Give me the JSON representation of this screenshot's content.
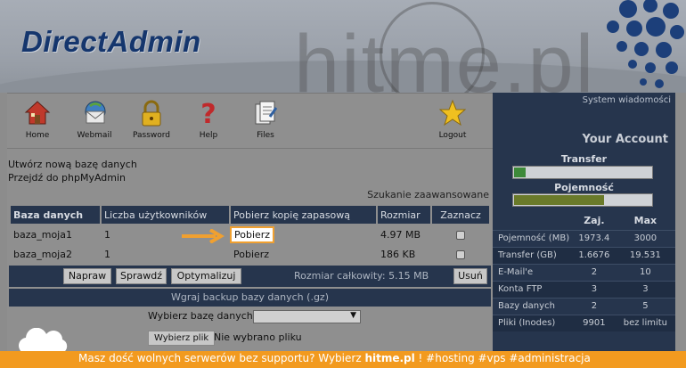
{
  "header": {
    "logo_text": "DirectAdmin",
    "watermark": "hitme.pl"
  },
  "toolbar": {
    "items": [
      {
        "label": "Home",
        "icon": "home-icon"
      },
      {
        "label": "Webmail",
        "icon": "webmail-icon"
      },
      {
        "label": "Password",
        "icon": "lock-icon"
      },
      {
        "label": "Help",
        "icon": "question-icon"
      },
      {
        "label": "Files",
        "icon": "files-icon"
      },
      {
        "label": "Logout",
        "icon": "star-icon"
      }
    ]
  },
  "links": {
    "create_db": "Utwórz nową bazę danych",
    "phpmyadmin": "Przejdź do phpMyAdmin",
    "advanced_search": "Szukanie zaawansowane"
  },
  "db_table": {
    "headers": [
      "Baza danych",
      "Liczba użytkowników",
      "Pobierz kopię zapasową",
      "Rozmiar",
      "Zaznacz"
    ],
    "rows": [
      {
        "name": "baza_moja1",
        "users": "1",
        "download": "Pobierz",
        "size": "4.97 MB",
        "highlighted": true
      },
      {
        "name": "baza_moja2",
        "users": "1",
        "download": "Pobierz",
        "size": "186 KB",
        "highlighted": false
      }
    ]
  },
  "actions": {
    "repair": "Napraw",
    "check": "Sprawdź",
    "optimize": "Optymalizuj",
    "total_size": "Rozmiar całkowity: 5.15 MB",
    "delete": "Usuń"
  },
  "backup": {
    "title": "Wgraj backup bazy danych (.gz)",
    "select_label": "Wybierz bazę danych",
    "select_value": "",
    "file_button": "Wybierz plik",
    "no_file": "Nie wybrano pliku"
  },
  "account": {
    "system_messages": "System wiadomości",
    "title": "Your Account",
    "transfer_label": "Transfer",
    "transfer_fraction": 0.085,
    "capacity_label": "Pojemność",
    "capacity_fraction": 0.65,
    "col_used": "Zaj.",
    "col_max": "Max",
    "rows": [
      {
        "key": "Pojemność (MB)",
        "used": "1973.4",
        "max": "3000"
      },
      {
        "key": "Transfer (GB)",
        "used": "1.6676",
        "max": "19.531"
      },
      {
        "key": "E-Mail'e",
        "used": "2",
        "max": "10"
      },
      {
        "key": "Konta FTP",
        "used": "3",
        "max": "3"
      },
      {
        "key": "Bazy danych",
        "used": "2",
        "max": "5"
      },
      {
        "key": "Pliki (Inodes)",
        "used": "9901",
        "max": "bez limitu"
      }
    ]
  },
  "banner": {
    "text_before": "Masz dość wolnych serwerów bez supportu? Wybierz ",
    "brand": "hitme.pl",
    "text_after": " !   #hosting #vps #administracja"
  },
  "colors": {
    "panel_dark": "#26354d",
    "banner_orange": "#f29a1f",
    "highlight_orange": "#f0a030"
  }
}
